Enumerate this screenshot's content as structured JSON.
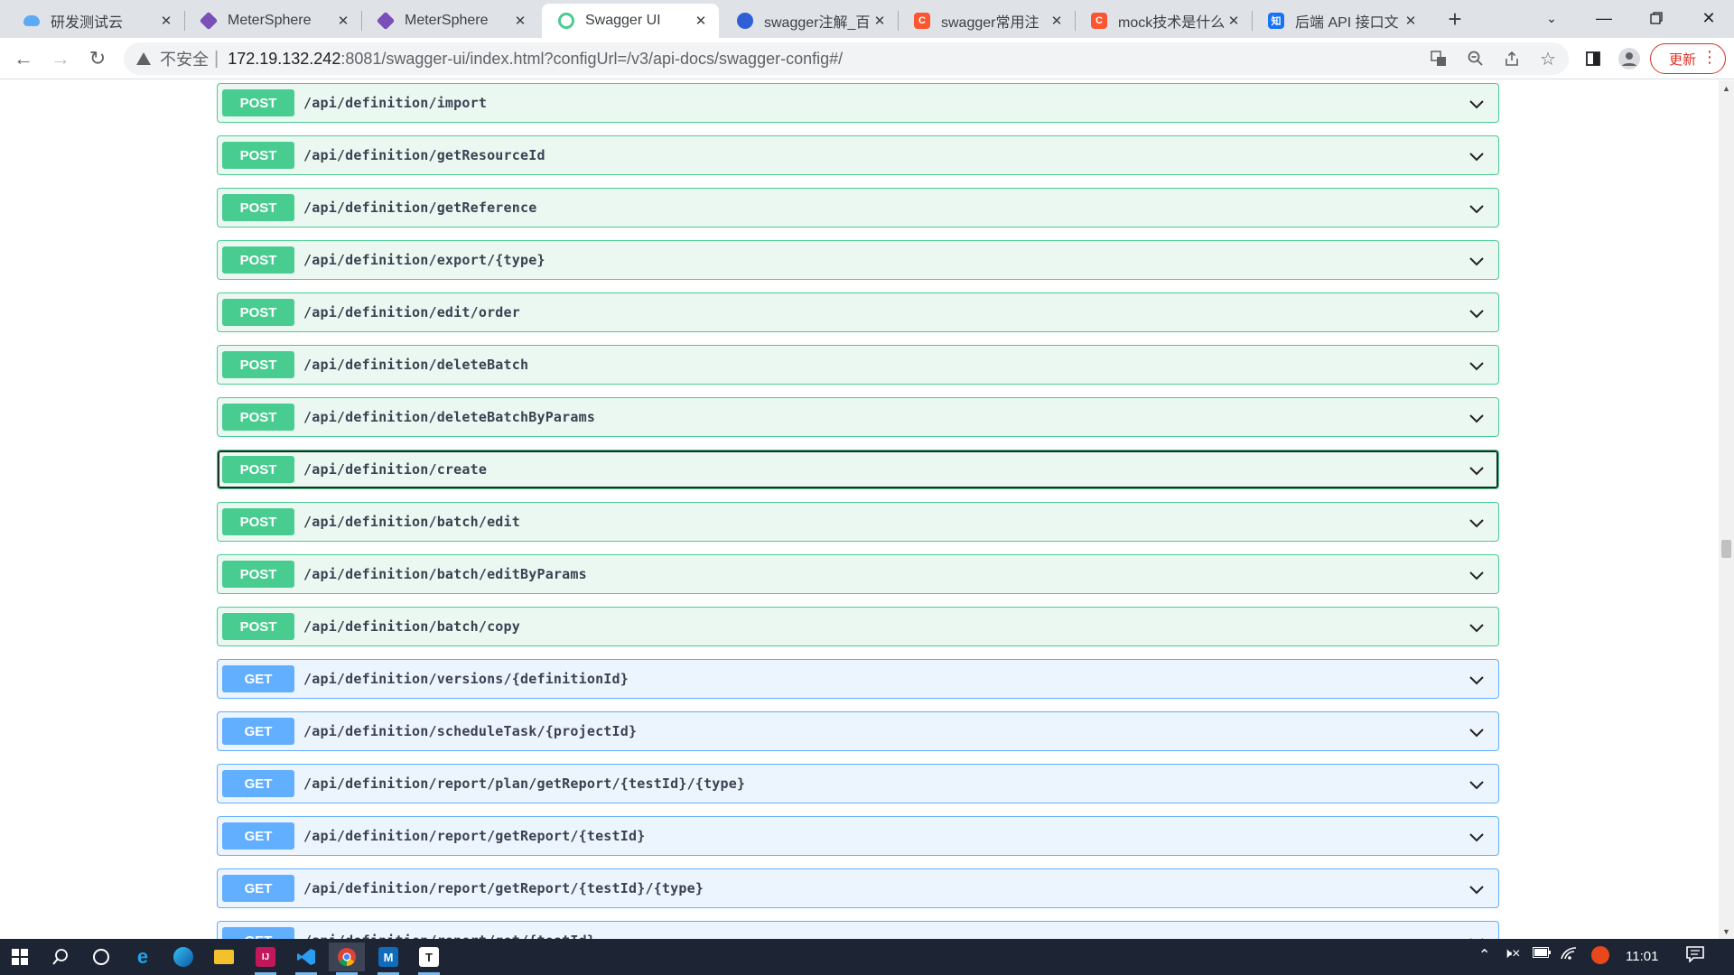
{
  "browser": {
    "tabs": [
      {
        "title": "研发测试云",
        "icon": "cloud-icon",
        "active": false
      },
      {
        "title": "MeterSphere",
        "icon": "metersphere-icon",
        "active": false
      },
      {
        "title": "MeterSphere",
        "icon": "metersphere-icon",
        "active": false
      },
      {
        "title": "Swagger UI",
        "icon": "swagger-icon",
        "active": true
      },
      {
        "title": "swagger注解_百",
        "icon": "baidu-icon",
        "active": false
      },
      {
        "title": "swagger常用注",
        "icon": "csdn-icon",
        "active": false
      },
      {
        "title": "mock技术是什么",
        "icon": "csdn-icon",
        "active": false
      },
      {
        "title": "后端 API 接口文",
        "icon": "zhihu-icon",
        "active": false
      }
    ],
    "fav_letters": {
      "csdn": "C",
      "zhihu": "知"
    },
    "security_label": "不安全",
    "url_host": "172.19.132.242",
    "url_rest": ":8081/swagger-ui/index.html?configUrl=/v3/api-docs/swagger-config#/",
    "update_label": "更新"
  },
  "operations": [
    {
      "method": "POST",
      "path": "/api/definition/import"
    },
    {
      "method": "POST",
      "path": "/api/definition/getResourceId"
    },
    {
      "method": "POST",
      "path": "/api/definition/getReference"
    },
    {
      "method": "POST",
      "path": "/api/definition/export/{type}"
    },
    {
      "method": "POST",
      "path": "/api/definition/edit/order"
    },
    {
      "method": "POST",
      "path": "/api/definition/deleteBatch"
    },
    {
      "method": "POST",
      "path": "/api/definition/deleteBatchByParams"
    },
    {
      "method": "POST",
      "path": "/api/definition/create",
      "focused": true
    },
    {
      "method": "POST",
      "path": "/api/definition/batch/edit"
    },
    {
      "method": "POST",
      "path": "/api/definition/batch/editByParams"
    },
    {
      "method": "POST",
      "path": "/api/definition/batch/copy"
    },
    {
      "method": "GET",
      "path": "/api/definition/versions/{definitionId}"
    },
    {
      "method": "GET",
      "path": "/api/definition/scheduleTask/{projectId}"
    },
    {
      "method": "GET",
      "path": "/api/definition/report/plan/getReport/{testId}/{type}"
    },
    {
      "method": "GET",
      "path": "/api/definition/report/getReport/{testId}"
    },
    {
      "method": "GET",
      "path": "/api/definition/report/getReport/{testId}/{type}"
    },
    {
      "method": "GET",
      "path": "/api/definition/report/get/{testId}"
    }
  ],
  "colors": {
    "post": "#49cc90",
    "get": "#61affe"
  },
  "taskbar": {
    "apps": [
      "windows-start-icon",
      "search-icon",
      "cortana-icon",
      "ie-icon",
      "edge-icon",
      "file-explorer-icon",
      "intellij-icon",
      "vscode-icon",
      "chrome-icon",
      "mail-icon",
      "typora-icon"
    ],
    "app_letters": {
      "intellij": "IJ",
      "mail": "M",
      "typora": "T"
    },
    "clock": "11:01"
  }
}
